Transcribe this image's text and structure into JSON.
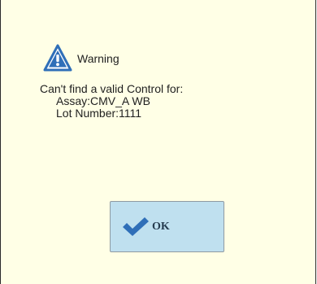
{
  "dialog": {
    "title": "Warning",
    "message": {
      "line1": "Can't find a valid Control for:",
      "line2": "Assay:CMV_A WB",
      "line3": "Lot Number:1111"
    },
    "ok_label": "OK"
  },
  "colors": {
    "background": "#ffffe6",
    "button": "#bfe0ef",
    "icon_blue": "#2f6fb8",
    "check_blue": "#2f6fb8"
  },
  "icons": {
    "warning": "warning-icon",
    "check": "check-icon"
  }
}
